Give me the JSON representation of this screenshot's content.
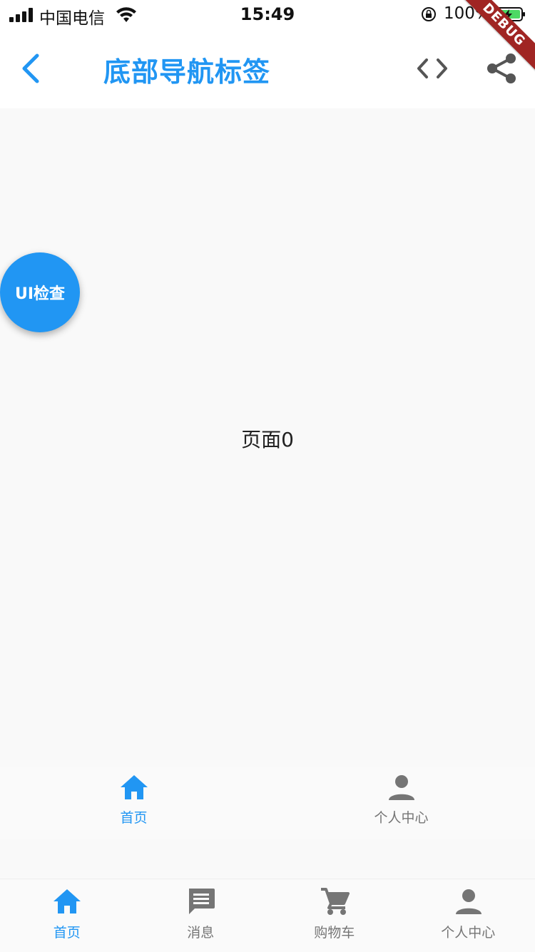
{
  "status_bar": {
    "carrier": "中国电信",
    "time": "15:49",
    "battery_percent": "100%"
  },
  "app_bar": {
    "title": "底部导航标签",
    "back_icon": "chevron-left-icon",
    "code_icon": "code-icon",
    "share_icon": "share-icon"
  },
  "debug_banner": "DEBUG",
  "fab": {
    "label": "UI检查"
  },
  "content": {
    "page_label": "页面0"
  },
  "inner_tabs": [
    {
      "label": "首页",
      "icon": "home-icon",
      "active": true
    },
    {
      "label": "个人中心",
      "icon": "person-icon",
      "active": false
    }
  ],
  "bottom_nav": [
    {
      "label": "首页",
      "icon": "home-icon",
      "active": true
    },
    {
      "label": "消息",
      "icon": "message-icon",
      "active": false
    },
    {
      "label": "购物车",
      "icon": "cart-icon",
      "active": false
    },
    {
      "label": "个人中心",
      "icon": "person-icon",
      "active": false
    }
  ],
  "colors": {
    "accent": "#2196f3",
    "inactive": "#757575",
    "debug": "#a02523",
    "battery": "#4cd964"
  }
}
